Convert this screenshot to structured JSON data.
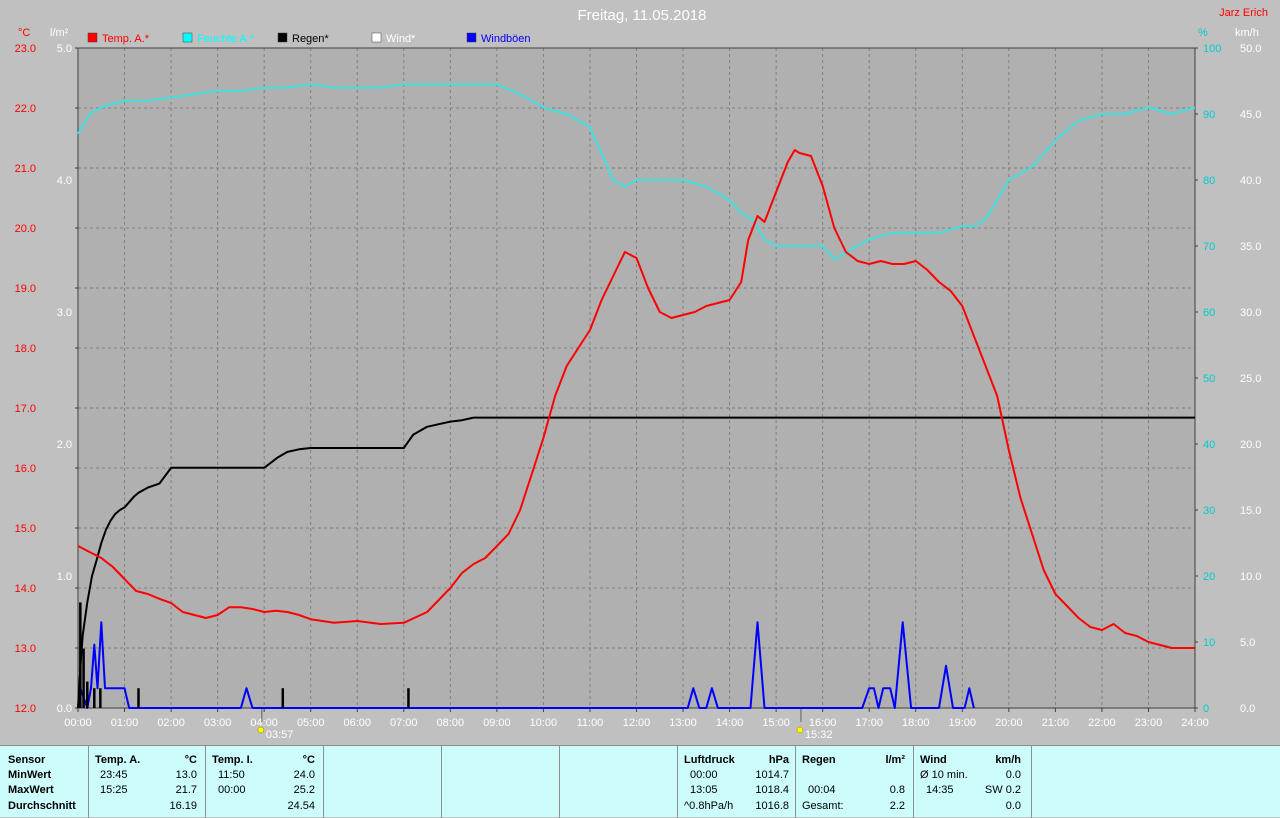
{
  "title": "Freitag, 11.05.2018",
  "author": "Jarz Erich",
  "axes": {
    "left1_unit": "°C",
    "left2_unit": "l/m²",
    "right1_unit": "%",
    "right2_unit": "km/h",
    "temp_ticks": [
      "23.0",
      "22.0",
      "21.0",
      "20.0",
      "19.0",
      "18.0",
      "17.0",
      "16.0",
      "15.0",
      "14.0",
      "13.0",
      "12.0"
    ],
    "rain_ticks": [
      "5.0",
      "4.0",
      "3.0",
      "2.0",
      "1.0",
      "0.0"
    ],
    "hum_ticks": [
      "100",
      "90",
      "80",
      "70",
      "60",
      "50",
      "40",
      "30",
      "20",
      "10",
      "0"
    ],
    "wind_ticks": [
      "50.0",
      "45.0",
      "40.0",
      "35.0",
      "30.0",
      "25.0",
      "20.0",
      "15.0",
      "10.0",
      "5.0",
      "0.0"
    ],
    "x_ticks": [
      "00:00",
      "01:00",
      "02:00",
      "03:00",
      "04:00",
      "05:00",
      "06:00",
      "07:00",
      "08:00",
      "09:00",
      "10:00",
      "11:00",
      "12:00",
      "13:00",
      "14:00",
      "15:00",
      "16:00",
      "17:00",
      "18:00",
      "19:00",
      "20:00",
      "21:00",
      "22:00",
      "23:00",
      "24:00"
    ],
    "sunrise": "03:57",
    "sunset": "15:32"
  },
  "legend": [
    {
      "label": "Temp. A.*",
      "color": "#ff0000"
    },
    {
      "label": "Feuchte A.*",
      "color": "#00ffff"
    },
    {
      "label": "Regen*",
      "color": "#000000"
    },
    {
      "label": "Wind*",
      "color": "#ffffff"
    },
    {
      "label": "Windböen",
      "color": "#0000ff"
    }
  ],
  "colors": {
    "background": "#c0c0c0",
    "plot_area": "#b0b0b0",
    "temperature": "#ff0000",
    "humidity": "#40e0e0",
    "rain": "#000000",
    "gusts": "#0000ff",
    "left_axis_text": "#ff0000",
    "right_axis_text": "#00cccc",
    "panel": "#ccfcfc"
  },
  "chart_data": {
    "type": "line",
    "title": "Freitag, 11.05.2018",
    "xlim": [
      0,
      24
    ],
    "grid": true,
    "legend_position": "top",
    "series": [
      {
        "name": "Temp. A.*",
        "axis": "°C",
        "ylim": [
          12,
          23
        ],
        "x": [
          0,
          0.25,
          0.5,
          0.75,
          1.0,
          1.25,
          1.5,
          1.75,
          2.0,
          2.25,
          2.5,
          2.75,
          3.0,
          3.25,
          3.5,
          3.75,
          4.0,
          4.25,
          4.5,
          4.75,
          5.0,
          5.5,
          6.0,
          6.5,
          7.0,
          7.5,
          7.75,
          8.0,
          8.25,
          8.5,
          8.75,
          9.0,
          9.25,
          9.5,
          9.75,
          10.0,
          10.25,
          10.5,
          10.75,
          11.0,
          11.25,
          11.5,
          11.75,
          12.0,
          12.25,
          12.5,
          12.75,
          13.0,
          13.25,
          13.5,
          13.75,
          14.0,
          14.25,
          14.4,
          14.6,
          14.75,
          15.0,
          15.25,
          15.4,
          15.5,
          15.75,
          16.0,
          16.25,
          16.5,
          16.75,
          17.0,
          17.25,
          17.5,
          17.75,
          18.0,
          18.25,
          18.5,
          18.75,
          19.0,
          19.25,
          19.5,
          19.75,
          20.0,
          20.25,
          20.5,
          20.75,
          21.0,
          21.25,
          21.5,
          21.75,
          22.0,
          22.25,
          22.5,
          22.75,
          23.0,
          23.25,
          23.5,
          23.75,
          24.0
        ],
        "values": [
          14.7,
          14.6,
          14.5,
          14.35,
          14.15,
          13.95,
          13.9,
          13.82,
          13.75,
          13.6,
          13.55,
          13.5,
          13.55,
          13.68,
          13.68,
          13.65,
          13.6,
          13.62,
          13.6,
          13.55,
          13.48,
          13.42,
          13.45,
          13.4,
          13.42,
          13.6,
          13.8,
          14.0,
          14.25,
          14.4,
          14.5,
          14.7,
          14.9,
          15.3,
          15.9,
          16.5,
          17.2,
          17.7,
          18.0,
          18.3,
          18.8,
          19.2,
          19.6,
          19.5,
          19.0,
          18.6,
          18.5,
          18.55,
          18.6,
          18.7,
          18.75,
          18.8,
          19.1,
          19.8,
          20.2,
          20.1,
          20.6,
          21.1,
          21.3,
          21.25,
          21.2,
          20.7,
          20.0,
          19.6,
          19.45,
          19.4,
          19.45,
          19.4,
          19.4,
          19.45,
          19.3,
          19.1,
          18.95,
          18.7,
          18.2,
          17.7,
          17.2,
          16.3,
          15.5,
          14.9,
          14.3,
          13.9,
          13.7,
          13.5,
          13.35,
          13.3,
          13.4,
          13.25,
          13.2,
          13.1,
          13.05,
          13.0,
          13.0,
          13.0
        ]
      },
      {
        "name": "Feuchte A.*",
        "axis": "%",
        "ylim": [
          0,
          100
        ],
        "x": [
          0,
          0.25,
          0.5,
          0.75,
          1.0,
          1.5,
          2.0,
          2.5,
          3.0,
          3.5,
          4.0,
          4.5,
          5.0,
          5.5,
          6.0,
          6.5,
          7.0,
          7.5,
          8.0,
          8.5,
          9.0,
          9.5,
          10.0,
          10.5,
          11.0,
          11.25,
          11.5,
          11.75,
          12.0,
          12.5,
          13.0,
          13.5,
          14.0,
          14.25,
          14.5,
          14.75,
          15.0,
          15.5,
          16.0,
          16.25,
          16.5,
          17.0,
          17.5,
          18.0,
          18.5,
          19.0,
          19.25,
          19.5,
          19.75,
          20.0,
          20.5,
          21.0,
          21.5,
          22.0,
          22.5,
          23.0,
          23.5,
          24.0
        ],
        "values": [
          87,
          90,
          91,
          91.5,
          92,
          92,
          92.5,
          93,
          93.5,
          93.5,
          94,
          94,
          94.5,
          94,
          94,
          94,
          94.5,
          94.5,
          94.5,
          94.5,
          94.5,
          93,
          91,
          90,
          88,
          84,
          80,
          79,
          80,
          80,
          80,
          79,
          77,
          75,
          74,
          71,
          70,
          70,
          70,
          68,
          69,
          71,
          72,
          72,
          72,
          73,
          73,
          74,
          77,
          80,
          82,
          86,
          89,
          90,
          90,
          91,
          90,
          91
        ]
      },
      {
        "name": "Regen*",
        "axis": "l/m²",
        "ylim": [
          0,
          5
        ],
        "x": [
          0,
          0.05,
          0.1,
          0.2,
          0.3,
          0.4,
          0.5,
          0.6,
          0.7,
          0.8,
          0.9,
          1.0,
          1.1,
          1.2,
          1.3,
          1.5,
          1.75,
          2.0,
          2.5,
          3.0,
          4.0,
          4.3,
          4.5,
          4.75,
          5.0,
          6.0,
          7.0,
          7.2,
          7.5,
          7.75,
          8.0,
          8.25,
          8.5,
          9.0,
          12.0,
          15.0,
          18.0,
          21.0,
          24.0
        ],
        "values": [
          0,
          0.3,
          0.55,
          0.8,
          1.0,
          1.12,
          1.25,
          1.35,
          1.42,
          1.47,
          1.5,
          1.52,
          1.56,
          1.6,
          1.63,
          1.67,
          1.7,
          1.82,
          1.82,
          1.82,
          1.82,
          1.9,
          1.94,
          1.96,
          1.97,
          1.97,
          1.97,
          2.07,
          2.13,
          2.15,
          2.17,
          2.18,
          2.2,
          2.2,
          2.2,
          2.2,
          2.2,
          2.2,
          2.2
        ]
      },
      {
        "name": "Windböen",
        "axis": "km/h",
        "ylim": [
          0,
          50
        ],
        "x": [
          0,
          0.05,
          0.1,
          0.15,
          0.2,
          0.28,
          0.35,
          0.42,
          0.5,
          0.58,
          0.65,
          0.72,
          0.8,
          1.0,
          1.1,
          3.5,
          3.62,
          3.75,
          13.1,
          13.22,
          13.35,
          13.5,
          13.62,
          13.75,
          14.45,
          14.6,
          14.75,
          16.85,
          17.0,
          17.1,
          17.2,
          17.3,
          17.45,
          17.55,
          17.72,
          17.9,
          18.5,
          18.65,
          18.8,
          19.05,
          19.15,
          19.25
        ],
        "values": [
          0,
          1.5,
          1.0,
          0.5,
          0,
          1.5,
          4.8,
          1.5,
          6.5,
          1.5,
          1.5,
          1.5,
          1.5,
          1.5,
          0,
          0,
          1.5,
          0,
          0,
          1.5,
          0,
          0,
          1.5,
          0,
          0,
          6.5,
          0,
          0,
          1.5,
          1.5,
          0,
          1.5,
          1.5,
          0,
          6.5,
          0,
          0,
          3.2,
          0,
          0,
          1.5,
          0
        ]
      }
    ],
    "rain_bars": {
      "x": [
        0.05,
        0.12,
        0.2,
        0.35,
        0.48,
        1.3,
        4.4,
        7.1
      ],
      "values": [
        0.8,
        0.45,
        0.2,
        0.15,
        0.15,
        0.15,
        0.15,
        0.15
      ]
    }
  },
  "stats": {
    "sensor": {
      "label": "Sensor",
      "min": "MinWert",
      "max": "MaxWert",
      "avg": "Durchschnitt"
    },
    "temp_a": {
      "label": "Temp. A.",
      "unit": "°C",
      "min_time": "23:45",
      "min_val": "13.0",
      "max_time": "15:25",
      "max_val": "21.7",
      "avg": "16.19"
    },
    "temp_i": {
      "label": "Temp. I.",
      "unit": "°C",
      "min_time": "11:50",
      "min_val": "24.0",
      "max_time": "00:00",
      "max_val": "25.2",
      "avg": "24.54"
    },
    "pressure": {
      "label": "Luftdruck",
      "unit": "hPa",
      "min_time": "00:00",
      "min_val": "1014.7",
      "max_time": "13:05",
      "max_val": "1018.4",
      "avg_label": "^0.8hPa/h",
      "avg": "1016.8"
    },
    "rain": {
      "label": "Regen",
      "unit": "l/m²",
      "max_time": "00:04",
      "max_val": "0.8",
      "total_label": "Gesamt:",
      "total": "2.2"
    },
    "wind": {
      "label": "Wind",
      "unit": "km/h",
      "min_label": "Ø 10 min.",
      "min_val": "0.0",
      "max_time": "14:35",
      "max_val": "SW 0.2",
      "avg": "0.0"
    }
  }
}
